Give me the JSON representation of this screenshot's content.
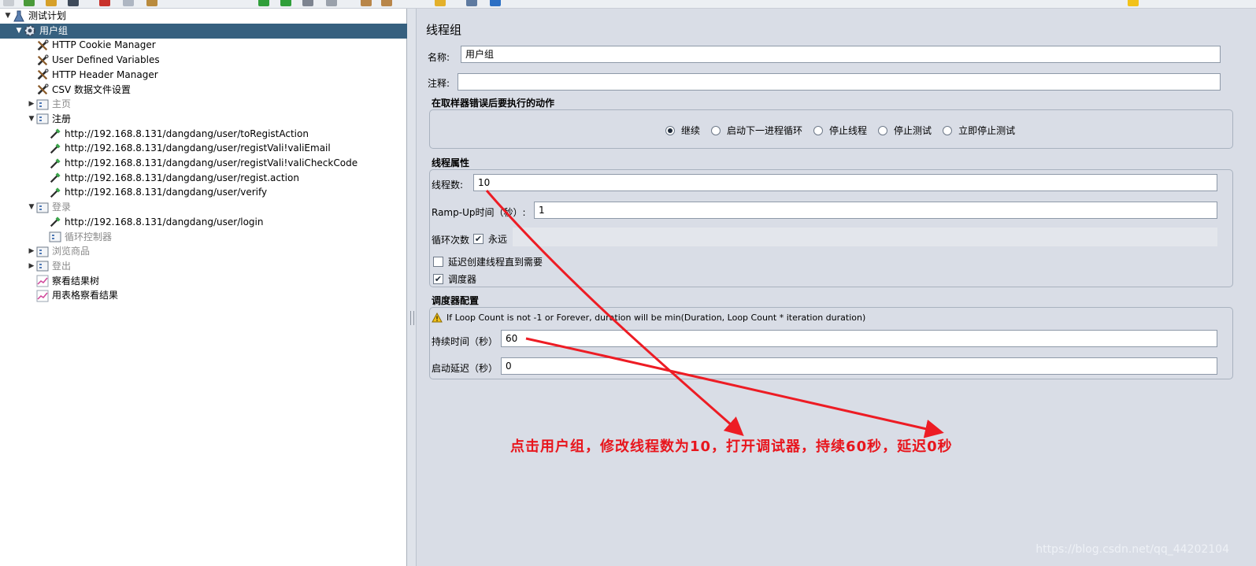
{
  "tree": {
    "nodes": [
      {
        "label": "测试计划",
        "icon": "flask-icon",
        "toggle": "▼",
        "level": 0,
        "state": "normal"
      },
      {
        "label": "用户组",
        "icon": "gear-icon",
        "toggle": "▼",
        "level": 1,
        "state": "selected"
      },
      {
        "label": "HTTP Cookie Manager",
        "icon": "wrench-icon",
        "toggle": "",
        "level": 2,
        "state": "normal"
      },
      {
        "label": "User Defined Variables",
        "icon": "wrench-icon",
        "toggle": "",
        "level": 2,
        "state": "normal"
      },
      {
        "label": "HTTP Header Manager",
        "icon": "wrench-icon",
        "toggle": "",
        "level": 2,
        "state": "normal"
      },
      {
        "label": "CSV 数据文件设置",
        "icon": "wrench-icon",
        "toggle": "",
        "level": 2,
        "state": "normal"
      },
      {
        "label": "主页",
        "icon": "controller-icon",
        "toggle": "▶",
        "level": 2,
        "state": "disabled"
      },
      {
        "label": "注册",
        "icon": "controller-icon",
        "toggle": "▼",
        "level": 2,
        "state": "normal"
      },
      {
        "label": "http://192.168.8.131/dangdang/user/toRegistAction",
        "icon": "pipette-icon",
        "toggle": "",
        "level": 3,
        "state": "normal"
      },
      {
        "label": "http://192.168.8.131/dangdang/user/registVali!valiEmail",
        "icon": "pipette-icon",
        "toggle": "",
        "level": 3,
        "state": "normal"
      },
      {
        "label": "http://192.168.8.131/dangdang/user/registVali!valiCheckCode",
        "icon": "pipette-icon",
        "toggle": "",
        "level": 3,
        "state": "normal"
      },
      {
        "label": "http://192.168.8.131/dangdang/user/regist.action",
        "icon": "pipette-icon",
        "toggle": "",
        "level": 3,
        "state": "normal"
      },
      {
        "label": "http://192.168.8.131/dangdang/user/verify",
        "icon": "pipette-icon",
        "toggle": "",
        "level": 3,
        "state": "normal"
      },
      {
        "label": "登录",
        "icon": "controller-icon",
        "toggle": "▼",
        "level": 2,
        "state": "disabled"
      },
      {
        "label": "http://192.168.8.131/dangdang/user/login",
        "icon": "pipette-icon",
        "toggle": "",
        "level": 3,
        "state": "normal"
      },
      {
        "label": "循环控制器",
        "icon": "controller-icon",
        "toggle": "",
        "level": 3,
        "state": "disabled"
      },
      {
        "label": "浏览商品",
        "icon": "controller-icon",
        "toggle": "▶",
        "level": 2,
        "state": "disabled"
      },
      {
        "label": "登出",
        "icon": "controller-icon",
        "toggle": "▶",
        "level": 2,
        "state": "disabled"
      },
      {
        "label": "察看结果树",
        "icon": "graph-icon",
        "toggle": "",
        "level": 2,
        "state": "normal"
      },
      {
        "label": "用表格察看结果",
        "icon": "graph-icon",
        "toggle": "",
        "level": 2,
        "state": "normal"
      }
    ]
  },
  "panel": {
    "title": "线程组",
    "name_label": "名称:",
    "name_value": "用户组",
    "comment_label": "注释:",
    "comment_value": "",
    "error_action": {
      "title": "在取样器错误后要执行的动作",
      "options": [
        "继续",
        "启动下一进程循环",
        "停止线程",
        "停止测试",
        "立即停止测试"
      ],
      "selected": "继续"
    },
    "thread_props": {
      "title": "线程属性",
      "threads_label": "线程数:",
      "threads_value": "10",
      "rampup_label": "Ramp-Up时间（秒）:",
      "rampup_value": "1",
      "loop_label": "循环次数",
      "forever_label": "永远",
      "forever_checked": true,
      "delay_label": "延迟创建线程直到需要",
      "delay_checked": false,
      "scheduler_label": "调度器",
      "scheduler_checked": true
    },
    "scheduler": {
      "title": "调度器配置",
      "warning": "If Loop Count is not -1 or Forever, duration will be min(Duration, Loop Count * iteration duration)",
      "duration_label": "持续时间（秒）",
      "duration_value": "60",
      "startup_label": "启动延迟（秒）",
      "startup_value": "0"
    }
  },
  "annotation": "点击用户组，修改线程数为10，打开调试器，持续60秒，延迟0秒",
  "watermark": "https://blog.csdn.net/qq_44202104",
  "colors": {
    "selected": "#36607f",
    "panel_bg": "#d9dde6",
    "annotation": "#e8161d"
  }
}
